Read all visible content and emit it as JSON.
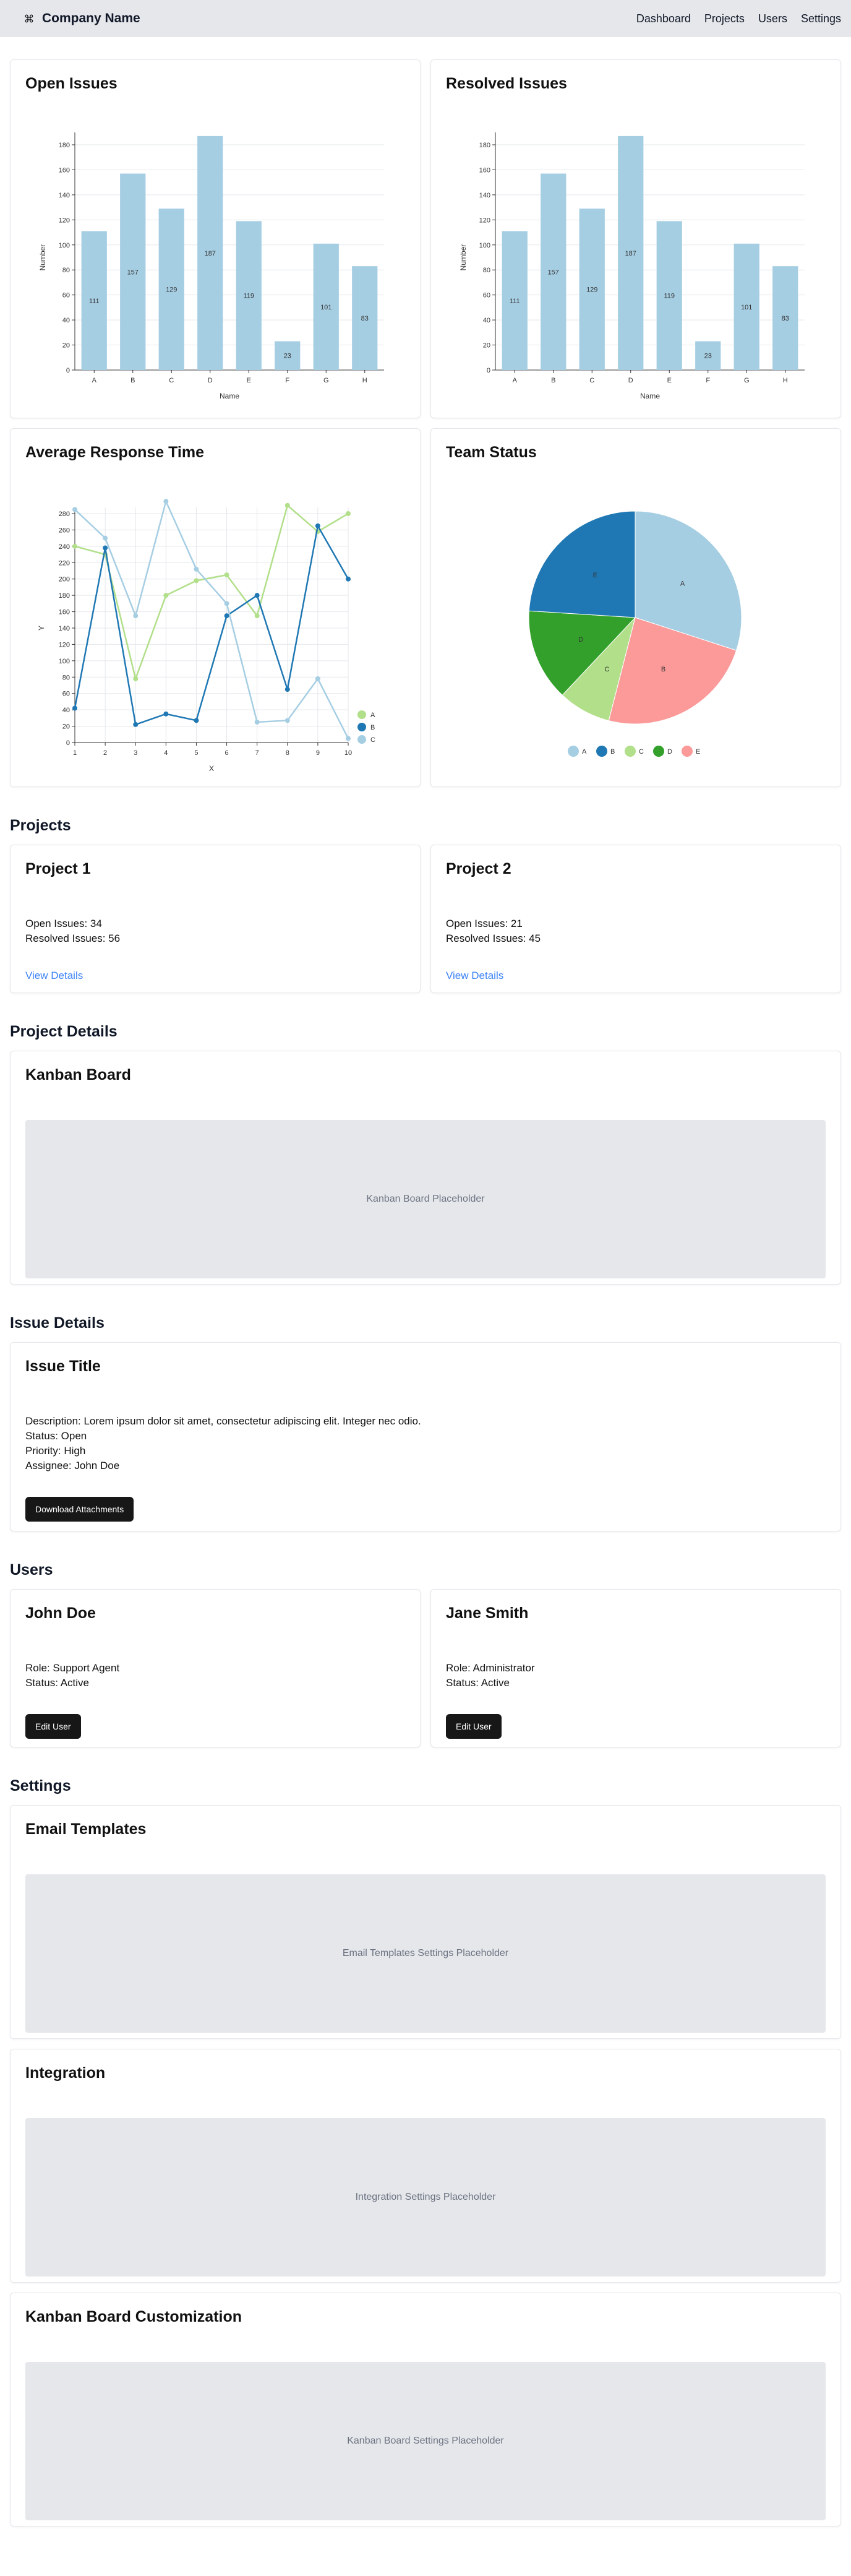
{
  "header": {
    "brand": "Company Name",
    "nav": [
      "Dashboard",
      "Projects",
      "Users",
      "Settings"
    ]
  },
  "cards": {
    "open_issues_title": "Open Issues",
    "resolved_issues_title": "Resolved Issues",
    "avg_response_title": "Average Response Time",
    "team_status_title": "Team Status"
  },
  "chart_data": [
    {
      "type": "bar",
      "title": "Open Issues",
      "xlabel": "Name",
      "ylabel": "Number",
      "categories": [
        "A",
        "B",
        "C",
        "D",
        "E",
        "F",
        "G",
        "H"
      ],
      "values": [
        111,
        157,
        129,
        187,
        119,
        23,
        101,
        83
      ],
      "ylim": [
        0,
        180
      ],
      "yticks": [
        0,
        20,
        40,
        60,
        80,
        100,
        120,
        140,
        160,
        180
      ],
      "color": "#a6cee3"
    },
    {
      "type": "bar",
      "title": "Resolved Issues",
      "xlabel": "Name",
      "ylabel": "Number",
      "categories": [
        "A",
        "B",
        "C",
        "D",
        "E",
        "F",
        "G",
        "H"
      ],
      "values": [
        111,
        157,
        129,
        187,
        119,
        23,
        101,
        83
      ],
      "ylim": [
        0,
        180
      ],
      "yticks": [
        0,
        20,
        40,
        60,
        80,
        100,
        120,
        140,
        160,
        180
      ],
      "color": "#a6cee3"
    },
    {
      "type": "line",
      "title": "Average Response Time",
      "xlabel": "X",
      "ylabel": "Y",
      "x": [
        1,
        2,
        3,
        4,
        5,
        6,
        7,
        8,
        9,
        10
      ],
      "ylim": [
        0,
        280
      ],
      "yticks": [
        0,
        20,
        40,
        60,
        80,
        100,
        120,
        140,
        160,
        180,
        200,
        220,
        240,
        260,
        280
      ],
      "legend": "right",
      "series": [
        {
          "name": "A",
          "color": "#b2df8a",
          "values": [
            240,
            230,
            78,
            180,
            198,
            205,
            155,
            290,
            258,
            280
          ]
        },
        {
          "name": "B",
          "color": "#1f78b4",
          "values": [
            42,
            238,
            22,
            35,
            27,
            155,
            180,
            65,
            265,
            200
          ]
        },
        {
          "name": "C",
          "color": "#a6cee3",
          "values": [
            285,
            250,
            155,
            295,
            212,
            170,
            25,
            27,
            78,
            5
          ]
        }
      ]
    },
    {
      "type": "pie",
      "title": "Team Status",
      "labels": [
        "A",
        "B",
        "C",
        "D",
        "E"
      ],
      "values": [
        30,
        24,
        8,
        14,
        24
      ],
      "colors": [
        "#a6cee3",
        "#fb9a99",
        "#b2df8a",
        "#33a02c",
        "#1f78b4"
      ],
      "legend_order": [
        "A",
        "B",
        "C",
        "D",
        "E"
      ],
      "legend_colors": [
        "#a6cee3",
        "#1f78b4",
        "#b2df8a",
        "#33a02c",
        "#fb9a99"
      ]
    }
  ],
  "projects": {
    "section_title": "Projects",
    "items": [
      {
        "name": "Project 1",
        "open": "Open Issues: 34",
        "resolved": "Resolved Issues: 56",
        "link": "View Details"
      },
      {
        "name": "Project 2",
        "open": "Open Issues: 21",
        "resolved": "Resolved Issues: 45",
        "link": "View Details"
      }
    ]
  },
  "project_details": {
    "section_title": "Project Details",
    "card_title": "Kanban Board",
    "placeholder": "Kanban Board Placeholder"
  },
  "issue_details": {
    "section_title": "Issue Details",
    "card_title": "Issue Title",
    "description": "Description: Lorem ipsum dolor sit amet, consectetur adipiscing elit. Integer nec odio.",
    "status": "Status: Open",
    "priority": "Priority: High",
    "assignee": "Assignee: John Doe",
    "button": "Download Attachments"
  },
  "users": {
    "section_title": "Users",
    "items": [
      {
        "name": "John Doe",
        "role": "Role: Support Agent",
        "status": "Status: Active",
        "button": "Edit User"
      },
      {
        "name": "Jane Smith",
        "role": "Role: Administrator",
        "status": "Status: Active",
        "button": "Edit User"
      }
    ]
  },
  "settings": {
    "section_title": "Settings",
    "items": [
      {
        "title": "Email Templates",
        "placeholder": "Email Templates Settings Placeholder"
      },
      {
        "title": "Integration",
        "placeholder": "Integration Settings Placeholder"
      },
      {
        "title": "Kanban Board Customization",
        "placeholder": "Kanban Board Settings Placeholder"
      }
    ]
  }
}
